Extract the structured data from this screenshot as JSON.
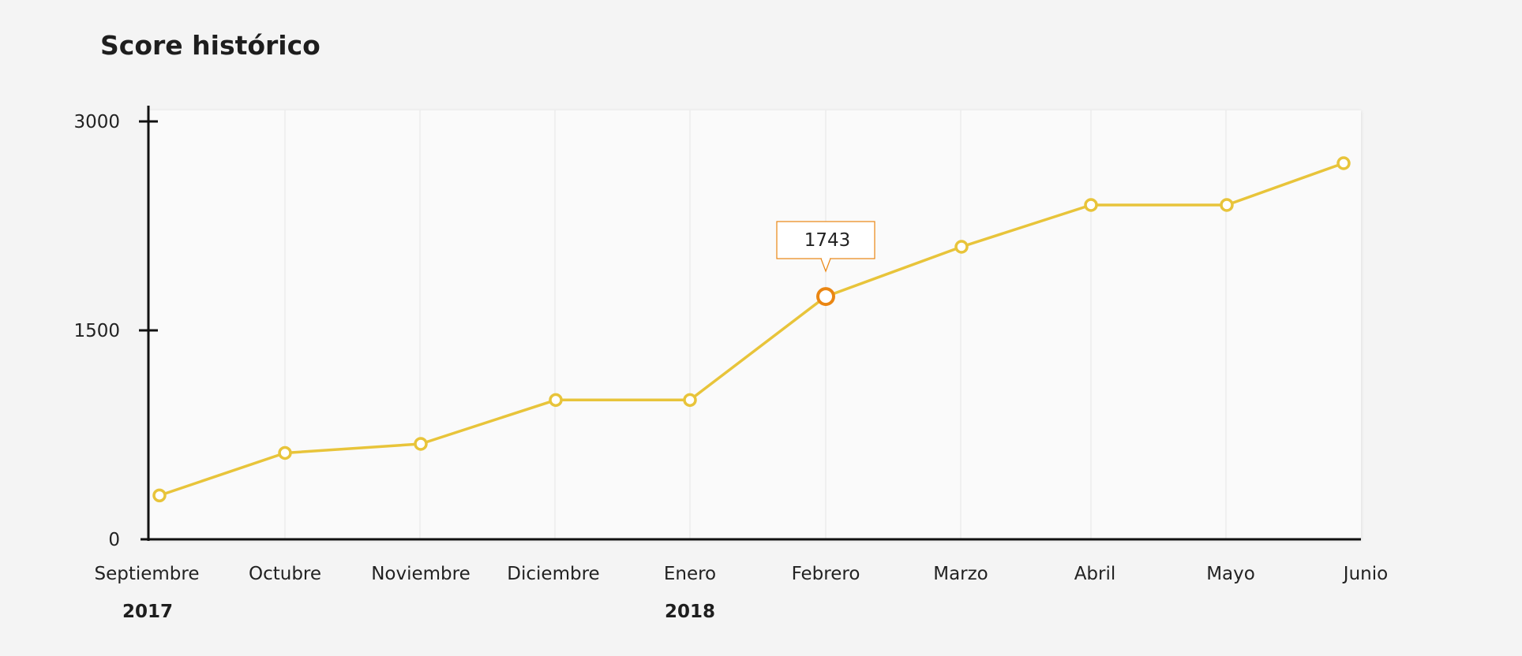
{
  "page": {
    "title": "Score histórico"
  },
  "colors": {
    "line": "#e8c43a",
    "highlight": "#ea8613",
    "plot_background": "#fafafa",
    "axis": "#111111",
    "grid": "#e6e6e6",
    "tooltip_border": "#ea8613"
  },
  "chart_data": {
    "type": "line",
    "title": "Score histórico",
    "xlabel": "",
    "ylabel": "",
    "categories": [
      "Septiembre",
      "Octubre",
      "Noviembre",
      "Diciembre",
      "Enero",
      "Febrero",
      "Marzo",
      "Abril",
      "Mayo",
      "Junio"
    ],
    "series": [
      {
        "values": [
          315,
          620,
          685,
          1000,
          1000,
          1743,
          2100,
          2400,
          2400,
          2700
        ]
      }
    ],
    "year_labels": [
      {
        "category": "Septiembre",
        "label": "2017"
      },
      {
        "category": "Enero",
        "label": "2018"
      }
    ],
    "y_ticks": [
      0,
      1500,
      3000
    ],
    "ylim": [
      0,
      3100
    ],
    "grid": "vertical",
    "legend": "none",
    "highlighted_point": {
      "category": "Febrero",
      "value": 1743,
      "tooltip": "1743"
    }
  }
}
